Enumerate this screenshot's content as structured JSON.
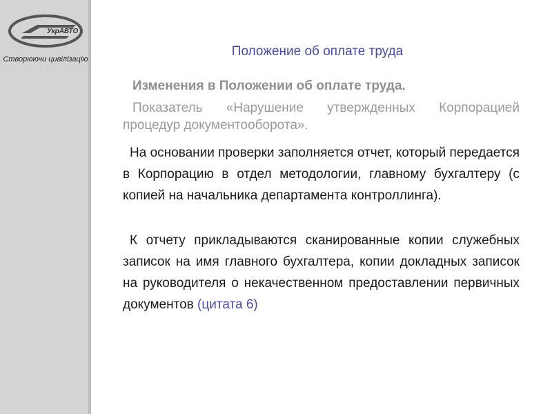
{
  "logo": {
    "text": "УкрАВТО",
    "tagline": "Створюючи цивілізацію"
  },
  "slide": {
    "title": "Положение об оплате труда",
    "subheading": "Изменения в Положении об оплате труда.",
    "indicator": "Показатель «Нарушение утвержденных Корпорацией процедур документооборота».",
    "para1": "На основании проверки заполняется отчет, который передается в Корпорацию в отдел методологии, главному бухгалтеру (с копией на начальника департамента контроллинга).",
    "para2": "К   отчету прикладываются сканированные копии служебных записок на имя главного бухгалтера, копии докладных записок на руководителя о некачественном предоставлении первичных документов",
    "citation": "(цитата 6)"
  }
}
